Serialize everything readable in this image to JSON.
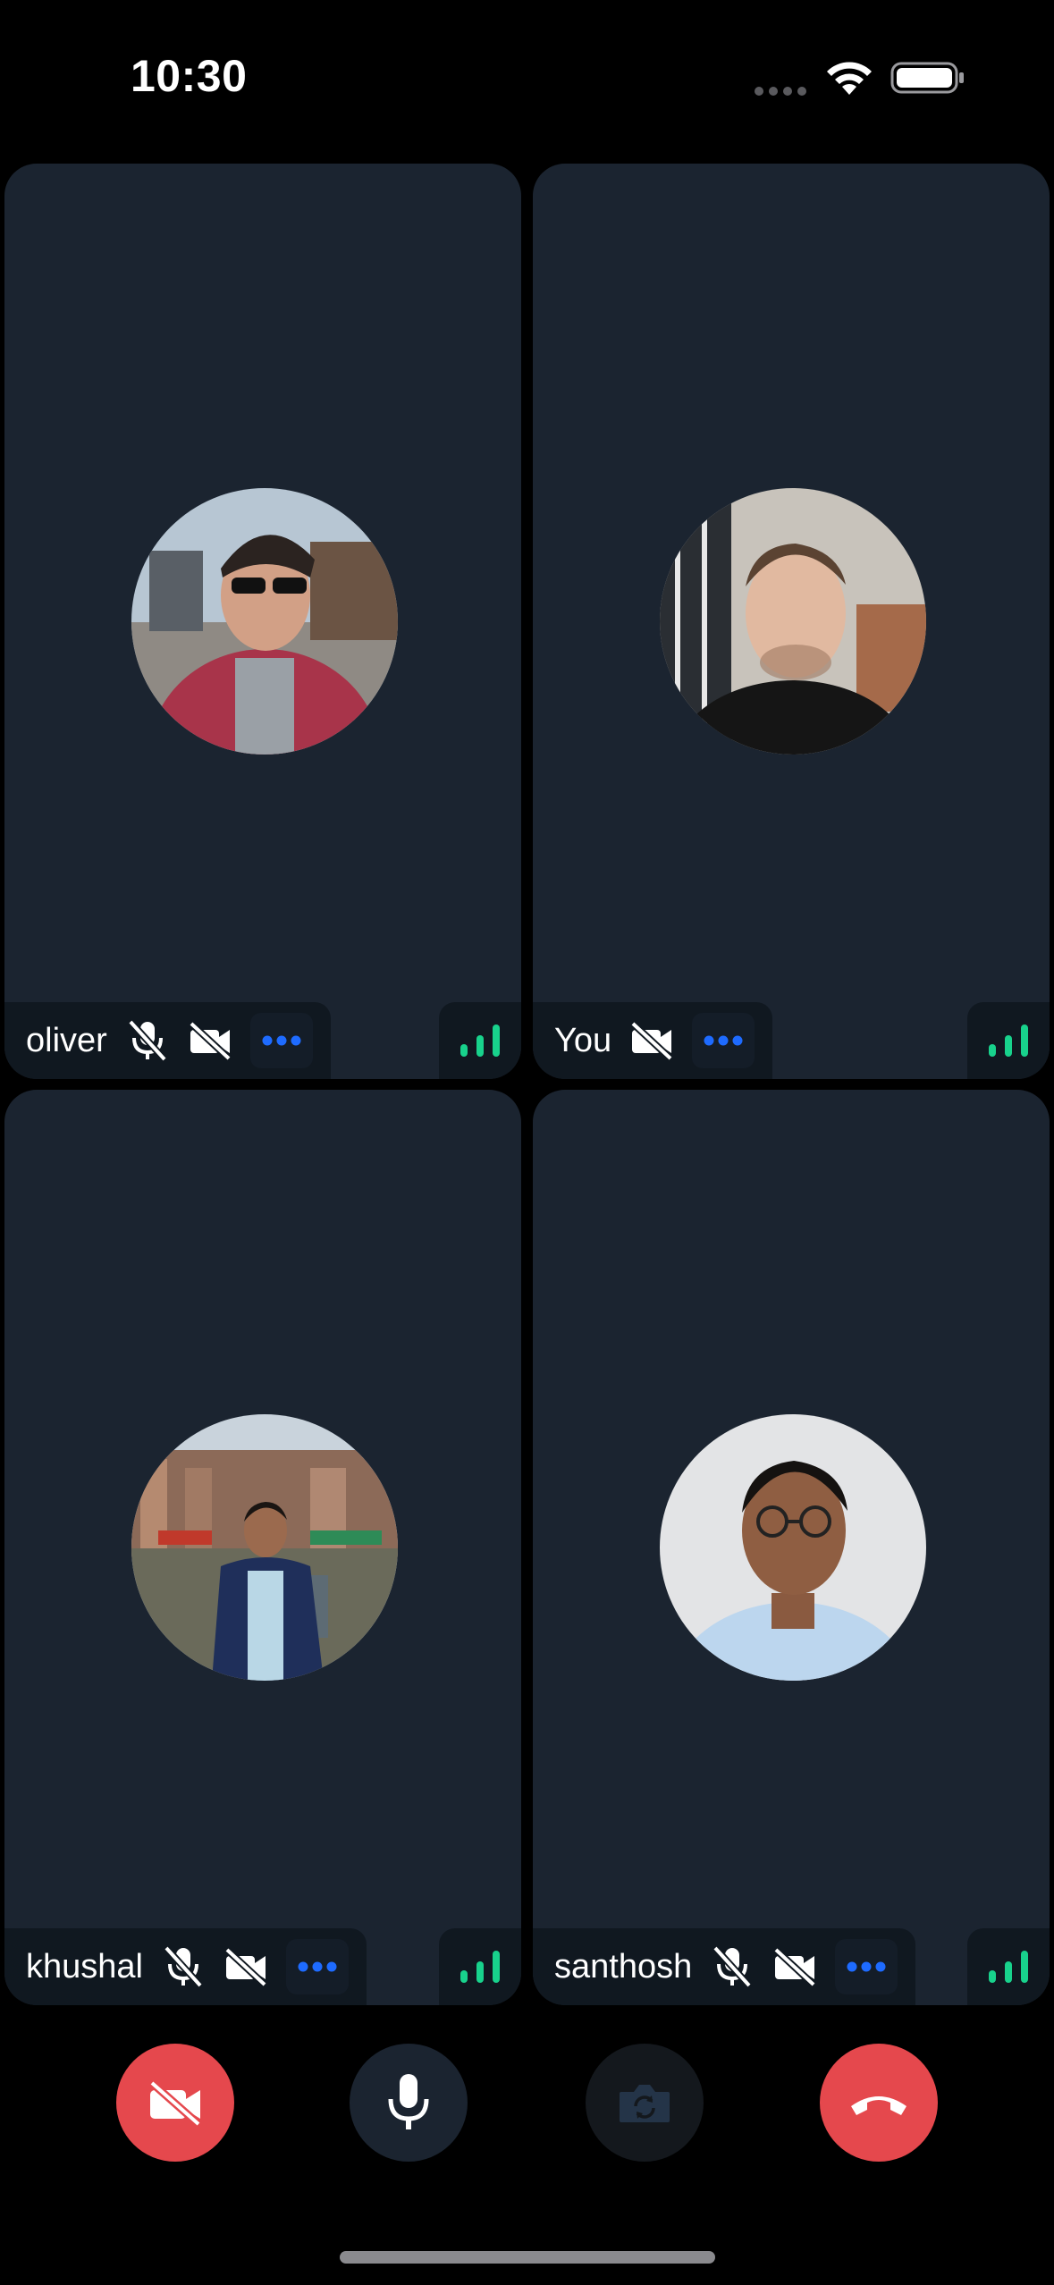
{
  "status_bar": {
    "time": "10:30",
    "icons": [
      "cellular-dots-icon",
      "wifi-icon",
      "battery-icon"
    ]
  },
  "participants": [
    {
      "name": "oliver",
      "mic_muted": true,
      "camera_off": true,
      "more_icon": "ellipsis-icon",
      "signal_icon": "signal-bars-icon"
    },
    {
      "name": "You",
      "mic_muted": false,
      "camera_off": true,
      "more_icon": "ellipsis-icon",
      "signal_icon": "signal-bars-icon"
    },
    {
      "name": "khushal",
      "mic_muted": true,
      "camera_off": true,
      "more_icon": "ellipsis-icon",
      "signal_icon": "signal-bars-icon"
    },
    {
      "name": "santhosh",
      "mic_muted": true,
      "camera_off": true,
      "more_icon": "ellipsis-icon",
      "signal_icon": "signal-bars-icon"
    }
  ],
  "controls": [
    {
      "id": "camera-toggle",
      "icon": "video-off-icon",
      "color": "#e5484d"
    },
    {
      "id": "microphone-toggle",
      "icon": "microphone-icon",
      "color": "#1b2430"
    },
    {
      "id": "flip-camera",
      "icon": "flip-camera-icon",
      "color": "#14181d"
    },
    {
      "id": "hang-up",
      "icon": "end-call-icon",
      "color": "#e5484d"
    }
  ],
  "colors": {
    "background": "#000000",
    "tile": "#1b2430",
    "tile_bar": "#101820",
    "accent_blue": "#1e6bff",
    "signal_green": "#18d28c",
    "danger_red": "#e5484d"
  }
}
